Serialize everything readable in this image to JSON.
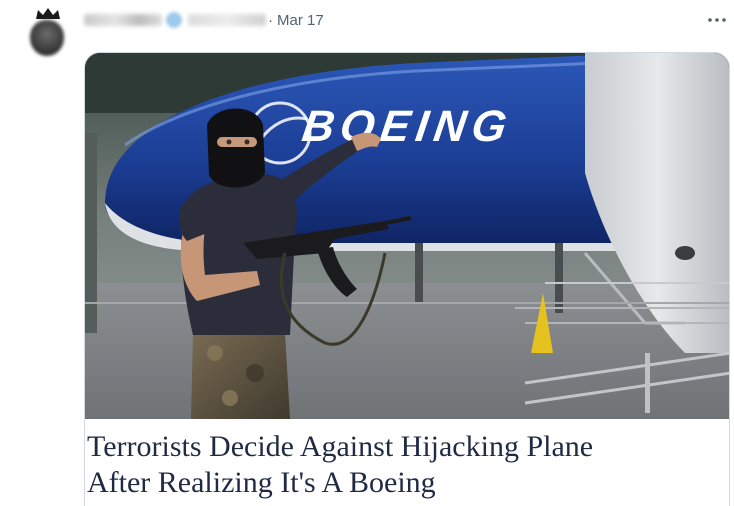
{
  "tweet": {
    "date": "Mar 17",
    "separator": "·",
    "more_icon": "more-horizontal-icon",
    "avatar_icon": "crown-icon"
  },
  "media": {
    "brand_text": "BOEING",
    "caption_line1": "Terrorists Decide Against Hijacking Plane",
    "caption_line2": "After Realizing It's A Boeing"
  },
  "colors": {
    "fuselage_blue": "#1c3f97",
    "caption_text": "#1f2a44",
    "meta_text": "#536471"
  }
}
